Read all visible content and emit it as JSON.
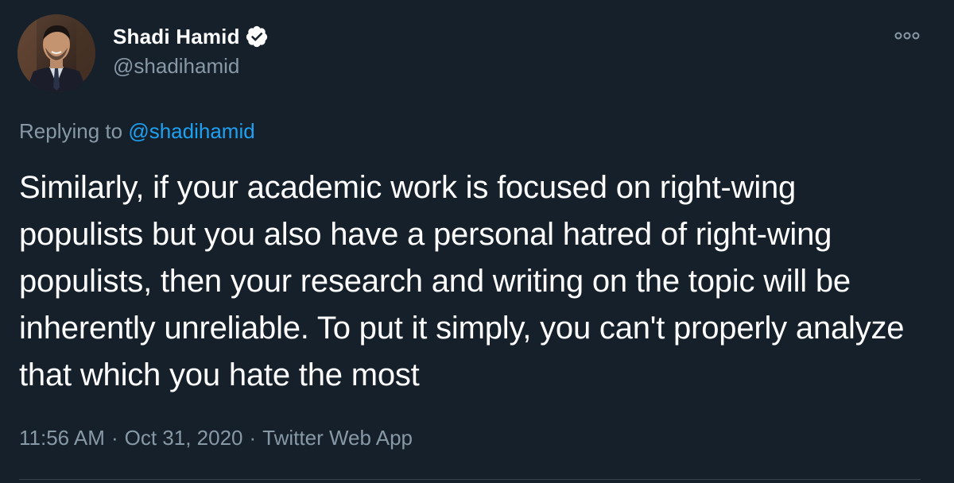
{
  "author": {
    "name": "Shadi Hamid",
    "handle": "@shadihamid",
    "verified": true
  },
  "reply": {
    "prefix": "Replying to ",
    "mention": "@shadihamid"
  },
  "tweet": {
    "text": "Similarly, if your academic work is focused on right-wing populists but you also have a personal hatred of right-wing populists, then your research and writing on the topic will be inherently unreliable. To put it simply, you can't properly analyze that which you hate the most"
  },
  "meta": {
    "time": "11:56 AM",
    "date": "Oct 31, 2020",
    "source": "Twitter Web App",
    "separator": "·"
  },
  "icons": {
    "verified": "verified-badge-icon",
    "more": "more-options-icon"
  },
  "colors": {
    "background": "#15202b",
    "text": "#ffffff",
    "secondary": "#8899a6",
    "link": "#1da1f2"
  }
}
